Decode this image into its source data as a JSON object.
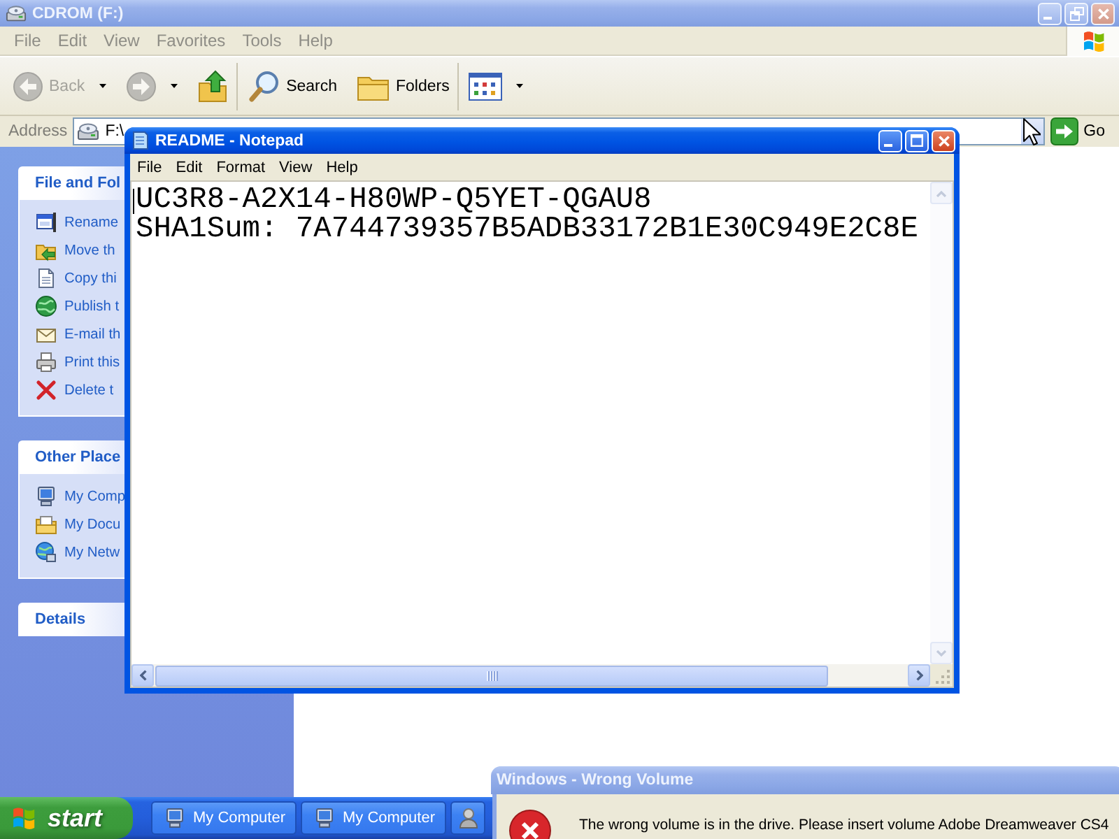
{
  "explorer": {
    "title": "CDROM (F:)",
    "active": false,
    "maximized": true,
    "menu": [
      "File",
      "Edit",
      "View",
      "Favorites",
      "Tools",
      "Help"
    ],
    "toolbar": [
      [
        {
          "kind": "back",
          "label": "Back",
          "disabled": true,
          "dropdown": true
        },
        {
          "kind": "forward",
          "disabled": true,
          "dropdown": true
        },
        {
          "kind": "up",
          "disabled": false,
          "dropdown": false
        }
      ],
      [
        {
          "kind": "search",
          "label": "Search",
          "disabled": false,
          "dropdown": false
        },
        {
          "kind": "folders",
          "label": "Folders",
          "disabled": false,
          "dropdown": false
        }
      ],
      [
        {
          "kind": "views",
          "disabled": false,
          "dropdown": true
        }
      ]
    ],
    "address": {
      "label": "Address",
      "value": "F:\\",
      "go": "Go"
    },
    "task_panes": [
      {
        "title": "File and Fol",
        "items": [
          {
            "kind": "rename",
            "label": "Rename"
          },
          {
            "kind": "move",
            "label": "Move th"
          },
          {
            "kind": "copy",
            "label": "Copy thi"
          },
          {
            "kind": "publish",
            "label": "Publish t"
          },
          {
            "kind": "email",
            "label": "E-mail th"
          },
          {
            "kind": "print",
            "label": "Print this"
          },
          {
            "kind": "delete",
            "label": "Delete t"
          }
        ]
      },
      {
        "title": "Other Place",
        "items": [
          {
            "kind": "computer",
            "label": "My Comp"
          },
          {
            "kind": "documents",
            "label": "My Docu"
          },
          {
            "kind": "network",
            "label": "My Netw"
          }
        ]
      },
      {
        "title": "Details"
      }
    ]
  },
  "notepad": {
    "title": "README - Notepad",
    "active": true,
    "maximized": false,
    "menu": [
      "File",
      "Edit",
      "Format",
      "View",
      "Help"
    ],
    "lines": [
      "UC3R8-A2X14-H80WP-Q5YET-QGAU8",
      "SHA1Sum: 7A744739357B5ADB33172B1E30C949E2C8E"
    ]
  },
  "dialog": {
    "title": "Windows - Wrong Volume",
    "active": false,
    "message": "The wrong volume is in the drive. Please insert volume Adobe Dreamweaver CS4"
  },
  "taskbar": {
    "start": "start",
    "tasks": [
      {
        "kind": "computer",
        "label": "My Computer",
        "selected": false
      },
      {
        "kind": "computer",
        "label": "My Computer",
        "selected": false
      },
      {
        "kind": "user",
        "selected": false
      }
    ]
  }
}
